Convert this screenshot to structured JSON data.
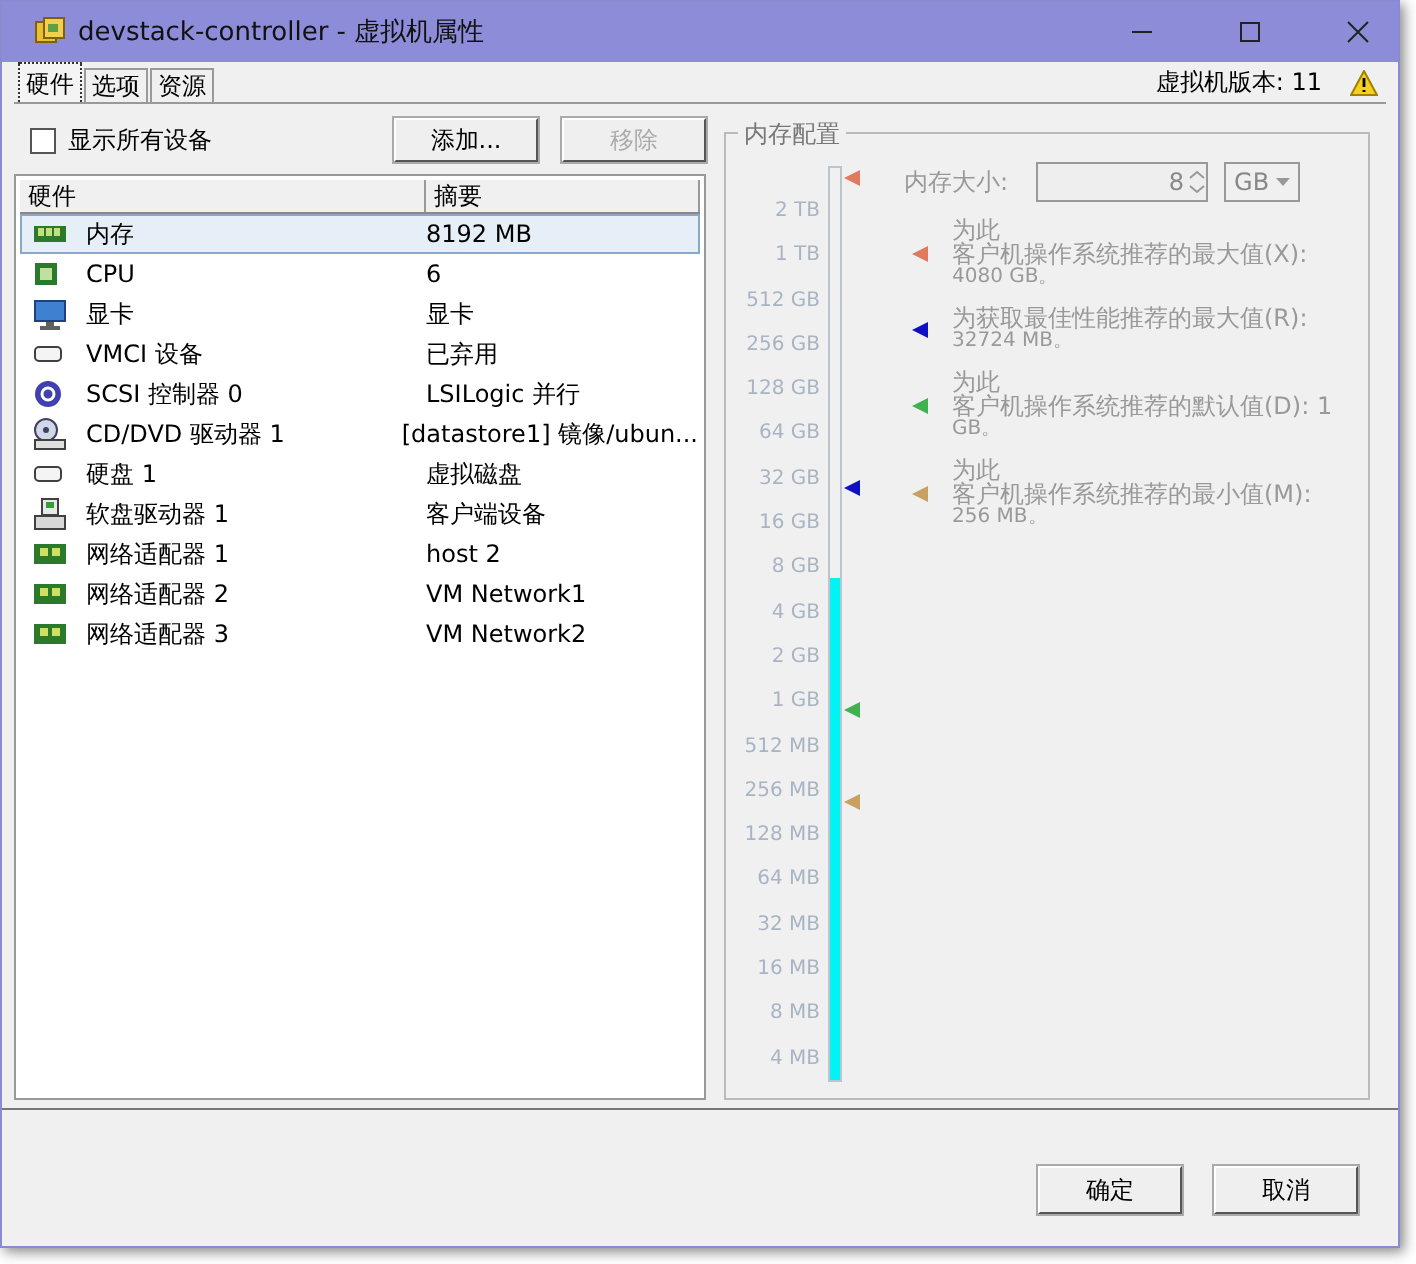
{
  "window": {
    "title": "devstack-controller - 虚拟机属性"
  },
  "tabs": [
    {
      "label": "硬件",
      "selected": true
    },
    {
      "label": "选项",
      "selected": false
    },
    {
      "label": "资源",
      "selected": false
    }
  ],
  "vm_version": "虚拟机版本: 11",
  "show_all_devices": {
    "label": "显示所有设备",
    "checked": false
  },
  "toolbar": [
    {
      "label": "添加...",
      "disabled": false
    },
    {
      "label": "移除",
      "disabled": true
    }
  ],
  "hardware": {
    "columns": [
      "硬件",
      "摘要"
    ],
    "rows": [
      {
        "kind": "memory",
        "name": "内存",
        "summary": "8192 MB",
        "selected": true
      },
      {
        "kind": "cpu",
        "name": "CPU",
        "summary": "6",
        "selected": false
      },
      {
        "kind": "display",
        "name": "显卡",
        "summary": "显卡",
        "selected": false
      },
      {
        "kind": "device",
        "name": "VMCI 设备",
        "summary": "已弃用",
        "selected": false
      },
      {
        "kind": "scsi",
        "name": "SCSI 控制器 0",
        "summary": "LSILogic 并行",
        "selected": false
      },
      {
        "kind": "cdrom",
        "name": "CD/DVD 驱动器 1",
        "summary": "[datastore1] 镜像/ubun...",
        "selected": false
      },
      {
        "kind": "device",
        "name": "硬盘 1",
        "summary": "虚拟磁盘",
        "selected": false
      },
      {
        "kind": "floppy",
        "name": "软盘驱动器 1",
        "summary": "客户端设备",
        "selected": false
      },
      {
        "kind": "nic",
        "name": "网络适配器 1",
        "summary": "host 2",
        "selected": false
      },
      {
        "kind": "nic",
        "name": "网络适配器 2",
        "summary": "VM Network1",
        "selected": false
      },
      {
        "kind": "nic",
        "name": "网络适配器 3",
        "summary": "VM Network2",
        "selected": false
      }
    ]
  },
  "memory": {
    "title": "内存配置",
    "size_label": "内存大小:",
    "size_value": "8",
    "unit": "GB",
    "level": 0.55,
    "ticks": [
      "2 TB",
      "1 TB",
      "512 GB",
      "256 GB",
      "128 GB",
      "64 GB",
      "32 GB",
      "16 GB",
      "8 GB",
      "4 GB",
      "2 GB",
      "1 GB",
      "512 MB",
      "256 MB",
      "128 MB",
      "64 MB",
      "32 MB",
      "16 MB",
      "8 MB",
      "4 MB"
    ],
    "recommendations": [
      {
        "lines": [
          "为此",
          "客户机操作系统推荐的最大值(X):",
          "4080 GB。"
        ],
        "color": "#e07a5f"
      },
      {
        "lines": [
          "为获取最佳性能推荐的最大值(R):",
          "32724 MB。"
        ],
        "color": "#1010c0"
      },
      {
        "lines": [
          "为此",
          "客户机操作系统推荐的默认值(D): 1",
          "GB。"
        ],
        "color": "#40b050"
      },
      {
        "lines": [
          "为此",
          "客户机操作系统推荐的最小值(M):",
          "256 MB。"
        ],
        "color": "#c8a060"
      }
    ],
    "scale_markers": [
      {
        "color": "#e07a5f",
        "level": 0.99
      },
      {
        "color": "#1010c0",
        "level": 0.65
      },
      {
        "color": "#40b050",
        "level": 0.405
      },
      {
        "color": "#c8a060",
        "level": 0.305
      }
    ]
  },
  "buttons": [
    "确定",
    "取消"
  ]
}
